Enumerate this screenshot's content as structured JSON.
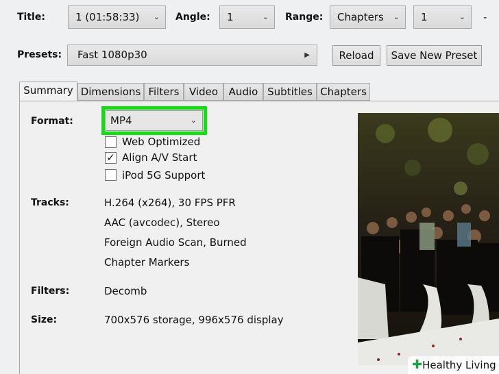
{
  "source": {
    "title_label": "Title:",
    "title_value": "1 (01:58:33)",
    "angle_label": "Angle:",
    "angle_value": "1",
    "range_label": "Range:",
    "range_type": "Chapters",
    "range_start": "1",
    "range_dash": "-"
  },
  "presets": {
    "label": "Presets:",
    "value": "Fast 1080p30",
    "reload_label": "Reload",
    "save_label": "Save New Preset"
  },
  "tabs": [
    {
      "label": "Summary"
    },
    {
      "label": "Dimensions"
    },
    {
      "label": "Filters"
    },
    {
      "label": "Video"
    },
    {
      "label": "Audio"
    },
    {
      "label": "Subtitles"
    },
    {
      "label": "Chapters"
    }
  ],
  "summary": {
    "format_label": "Format:",
    "format_value": "MP4",
    "options": [
      {
        "label": "Web Optimized",
        "checked": false
      },
      {
        "label": "Align A/V Start",
        "checked": true
      },
      {
        "label": "iPod 5G Support",
        "checked": false
      }
    ],
    "tracks_label": "Tracks:",
    "tracks": [
      "H.264 (x264), 30 FPS PFR",
      "AAC (avcodec), Stereo",
      "Foreign Audio Scan, Burned",
      "Chapter Markers"
    ],
    "filters_label": "Filters:",
    "filters_value": "Decomb",
    "size_label": "Size:",
    "size_value": "700x576 storage, 996x576 display"
  },
  "highlight_color": "#10e010",
  "watermark": {
    "text": "Healthy Living"
  }
}
